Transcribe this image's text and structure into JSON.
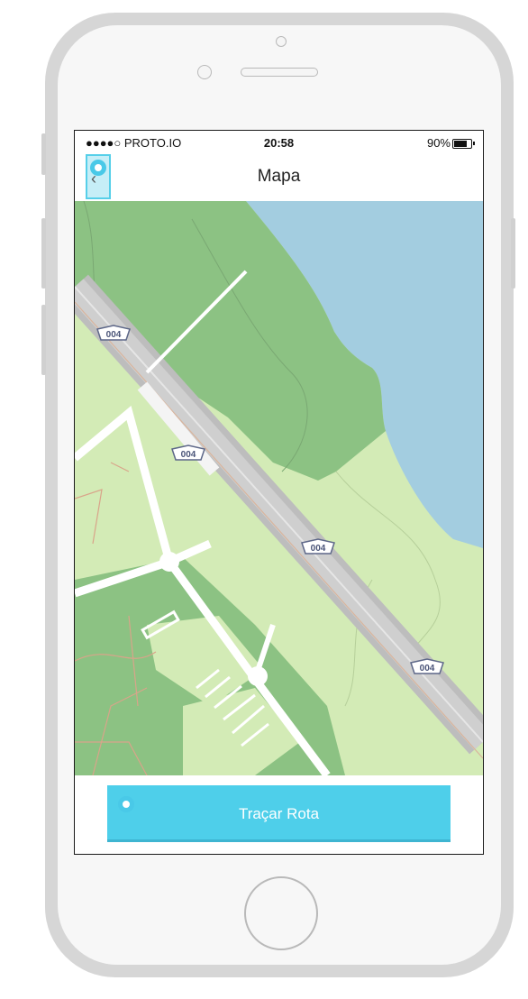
{
  "status_bar": {
    "carrier": "●●●●○ PROTO.IO",
    "time": "20:58",
    "battery_percent": "90%",
    "battery_level": 0.9
  },
  "nav": {
    "title": "Mapa",
    "back_icon": "chevron-left-icon",
    "marker_icon": "location-pin-icon"
  },
  "map": {
    "road_labels": [
      "004",
      "004",
      "004",
      "004"
    ],
    "colors": {
      "water": "#a3cde0",
      "forest": "#8cc283",
      "park": "#d3ebb6",
      "road": "#c9c9c9"
    }
  },
  "action": {
    "route_button_label": "Traçar Rota",
    "accent": "#4ecfea"
  }
}
